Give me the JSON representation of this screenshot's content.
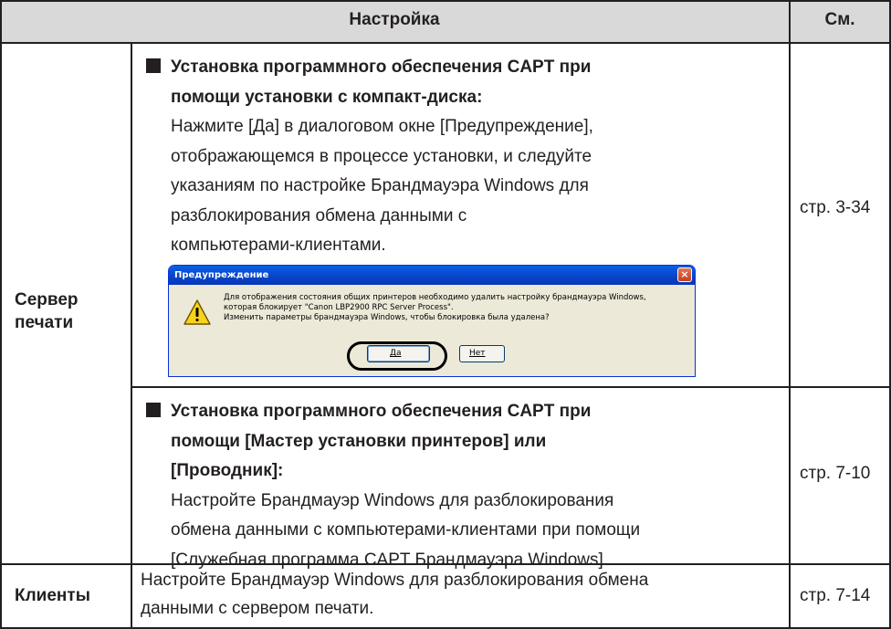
{
  "header": {
    "setting": "Настройка",
    "see": "См."
  },
  "rows": [
    {
      "label_line1": "Сервер",
      "label_line2": "печати"
    },
    {
      "label": "Клиенты"
    }
  ],
  "cd_section": {
    "title_line1": "Установка программного обеспечения CAPT при",
    "title_line2": "помощи установки с компакт-диска:",
    "body_lines": [
      "Нажмите [Да] в диалоговом окне [Предупреждение],",
      "отображающемся в процессе установки, и следуйте",
      "указаниям по настройке Брандмауэра Windows для",
      "разблокирования обмена данными с",
      "компьютерами-клиентами."
    ],
    "ref": "стр. 3-34"
  },
  "dialog": {
    "title": "Предупреждение",
    "close_glyph": "×",
    "message_lines": [
      "Для отображения состояния общих принтеров необходимо удалить настройку брандмауэра Windows,",
      "которая блокирует \"Canon LBP2900 RPC Server Process\".",
      "Изменить параметры брандмауэра Windows, чтобы блокировка была удалена?"
    ],
    "yes_label": "Да",
    "no_label": "Нет",
    "icon": "warning-icon"
  },
  "wizard_section": {
    "title_line1": "Установка программного обеспечения CAPT при",
    "title_line2": "помощи [Мастер установки принтеров] или",
    "title_line3": "[Проводник]:",
    "body_lines": [
      "Настройте Брандмауэр Windows для разблокирования",
      "обмена данными с компьютерами-клиентами при помощи",
      "[Служебная программа CAPT Брандмауэра Windows]."
    ],
    "ref": "стр. 7-10"
  },
  "clients_section": {
    "body_lines": [
      "Настройте Брандмауэр Windows для разблокирования обмена",
      "данными с сервером печати."
    ],
    "ref": "стр. 7-14"
  },
  "colors": {
    "header_bg": "#d9d9d9",
    "rule": "#231f20",
    "xp_title": "#0843c6",
    "xp_face": "#ece9d8"
  }
}
